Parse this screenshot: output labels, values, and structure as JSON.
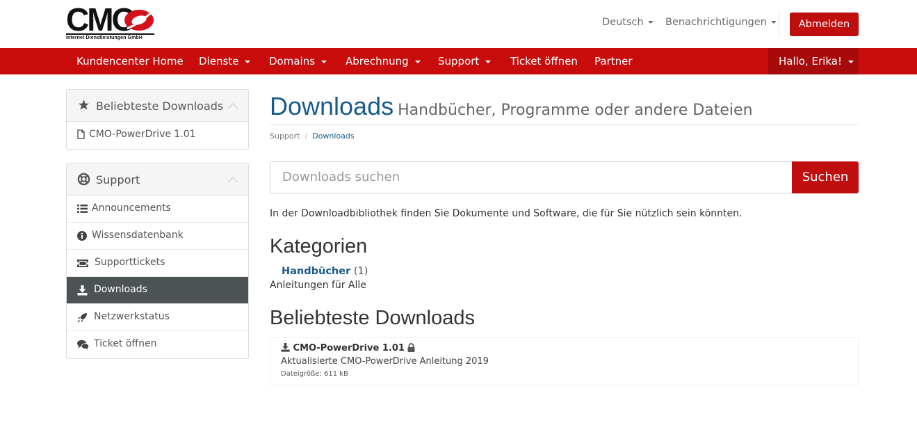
{
  "brand": {
    "logo_text": "CMO",
    "logo_subtext": "Internet Dienstleistungen GmbH",
    "accent": "#c80c0c"
  },
  "header": {
    "language": "Deutsch",
    "notifications": "Benachrichtigungen",
    "logout": "Abmelden"
  },
  "nav": {
    "items": [
      {
        "label": "Kundencenter Home"
      },
      {
        "label": "Dienste"
      },
      {
        "label": "Domains"
      },
      {
        "label": "Abrechnung"
      },
      {
        "label": "Support"
      },
      {
        "label": "Ticket öffnen"
      },
      {
        "label": "Partner"
      }
    ],
    "user": "Hallo, Erika!"
  },
  "sidebar": {
    "popular": {
      "title": "Beliebteste Downloads",
      "items": [
        {
          "label": "CMO-PowerDrive 1.01",
          "icon": "file-icon"
        }
      ]
    },
    "support": {
      "title": "Support",
      "items": [
        {
          "label": "Announcements",
          "icon": "list-icon"
        },
        {
          "label": "Wissensdatenbank",
          "icon": "info-icon"
        },
        {
          "label": "Supporttickets",
          "icon": "ticket-icon"
        },
        {
          "label": "Downloads",
          "icon": "download-icon",
          "active": true
        },
        {
          "label": "Netzwerkstatus",
          "icon": "rocket-icon"
        },
        {
          "label": "Ticket öffnen",
          "icon": "comments-icon"
        }
      ]
    }
  },
  "main": {
    "title": "Downloads",
    "subtitle": "Handbücher, Programme oder andere Dateien",
    "breadcrumb": [
      "Support",
      "Downloads"
    ],
    "search": {
      "placeholder": "Downloads suchen",
      "button": "Suchen"
    },
    "intro": "In der Downloadbibliothek finden Sie Dokumente und Software, die für Sie nützlich sein könnten.",
    "categories_heading": "Kategorien",
    "categories": [
      {
        "name": "Handbücher",
        "count": "(1)",
        "description": "Anleitungen für Alle"
      }
    ],
    "popular_heading": "Beliebteste Downloads",
    "downloads": [
      {
        "title": "CMO-PowerDrive 1.01",
        "description": "Aktualisierte CMO-PowerDrive Anleitung 2019",
        "size": "Dateigröße: 611 kB"
      }
    ]
  }
}
